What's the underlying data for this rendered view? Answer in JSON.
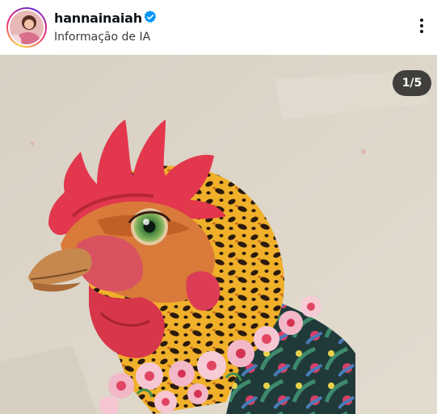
{
  "post": {
    "username": "hannainaiah",
    "verified": true,
    "subtitle": "Informação de IA",
    "counter": "1/5"
  },
  "icons": {
    "verified": "verified-badge-icon",
    "more": "more-vertical-icon"
  },
  "colors": {
    "verified_blue": "#0095f6",
    "counter_bg": "#1c1c1c",
    "canvas_bg": "#ddd5c8",
    "comb_red": "#e2374d",
    "feather_gold": "#e9a52a"
  }
}
